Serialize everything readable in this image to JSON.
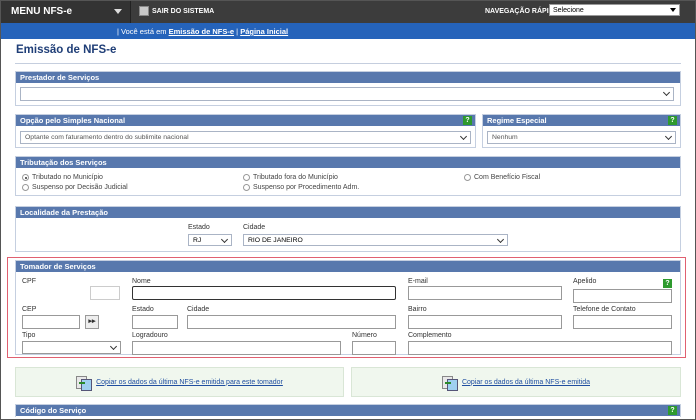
{
  "topbar": {
    "menu_label": "MENU NFS-e",
    "logout_label": "SAIR DO SISTEMA",
    "nav_label": "NAVEGAÇÃO RÁPIDA",
    "nav_select_value": "Selecione"
  },
  "breadcrumb": {
    "prefix": "Você está em",
    "current": "Emissão de NFS-e",
    "separator": "|",
    "home": "Página Inicial"
  },
  "page_title": "Emissão de NFS-e",
  "prestador": {
    "title": "Prestador de Serviços",
    "value": ""
  },
  "simples": {
    "title": "Opção pelo Simples Nacional",
    "value": "Optante com faturamento dentro do sublimite nacional",
    "help": "?"
  },
  "regime": {
    "title": "Regime Especial",
    "value": "Nenhum",
    "help": "?"
  },
  "tributacao": {
    "title": "Tributação dos Serviços",
    "options": [
      "Tributado no Município",
      "Tributado fora do Município",
      "Com Benefício Fiscal",
      "Suspenso por Decisão Judicial",
      "Suspenso por Procedimento Adm."
    ],
    "selected": "Tributado no Município"
  },
  "localidade": {
    "title": "Localidade da Prestação",
    "estado_label": "Estado",
    "estado_value": "RJ",
    "cidade_label": "Cidade",
    "cidade_value": "RIO DE JANEIRO"
  },
  "tomador": {
    "title": "Tomador de Serviços",
    "help": "?",
    "labels": {
      "cpf": "CPF",
      "nome": "Nome",
      "email": "E-mail",
      "apelido": "Apelido",
      "cep": "CEP",
      "estado": "Estado",
      "cidade": "Cidade",
      "bairro": "Bairro",
      "telefone": "Telefone de Contato",
      "tipo": "Tipo",
      "logradouro": "Logradouro",
      "numero": "Número",
      "complemento": "Complemento"
    },
    "cep_button": "▸▸"
  },
  "copy": {
    "tomador_link": "Copiar os dados da última NFS-e emitida para este tomador",
    "last_link": "Copiar os dados da última NFS-e emitida"
  },
  "codigo": {
    "title": "Código do Serviço",
    "help": "?"
  }
}
